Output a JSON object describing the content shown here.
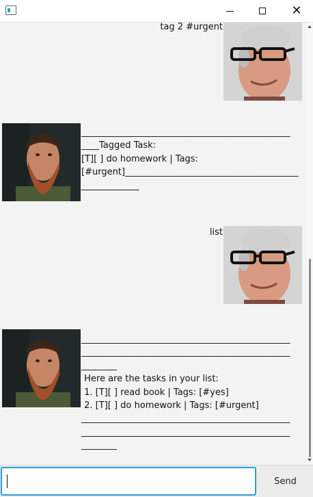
{
  "window": {
    "app_icon": "app-icon",
    "controls": [
      "minimize-icon",
      "maximize-icon",
      "close-icon"
    ]
  },
  "messages": [
    {
      "sender": "user",
      "text": "tag 2 #urgent"
    },
    {
      "sender": "bot",
      "text": "_______________________________________________\n____Tagged Task:\n[T][ ] do homework | Tags:\n[#urgent]_______________________________________\n_____________"
    },
    {
      "sender": "user",
      "text": "list"
    },
    {
      "sender": "bot",
      "text": "_______________________________________________\n_______________________________________________\n________\n Here are the tasks in your list:\n 1. [T][ ] read book | Tags: [#yes]\n 2. [T][ ] do homework | Tags: [#urgent]\n_______________________________________________\n_______________________________________________\n________"
    }
  ],
  "input": {
    "value": "",
    "placeholder": ""
  },
  "send_label": "Send"
}
